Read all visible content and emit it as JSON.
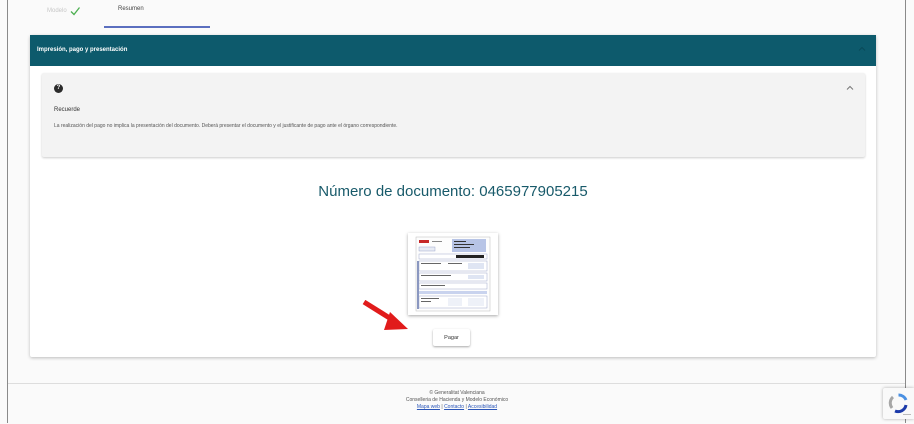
{
  "tabs": {
    "modelo": "Modelo",
    "resumen": "Resumen"
  },
  "section": {
    "title": "Impresión, pago y presentación"
  },
  "note": {
    "title": "Recuerde",
    "text": "La realización del pago no implica la presentación del documento. Deberá presentar el documento y el justificante de pago ante el órgano correspondiente."
  },
  "document": {
    "label": "Número de documento:",
    "number": "0465977905215"
  },
  "actions": {
    "pay": "Pagar"
  },
  "footer": {
    "line1": "© Generalitat Valenciana",
    "line2": "Conselleria de Hacienda y Modelo Económico",
    "link_mapa": "Mapa web",
    "link_contacto": "Contacto",
    "link_accesibilidad": "Accesibilidad",
    "separator": "|"
  },
  "colors": {
    "header": "#0d5a6c",
    "doc_number": "#185a6a",
    "tab_underline": "#5b6fbf",
    "arrow": "#e11b1b",
    "check": "#2e7d32"
  }
}
